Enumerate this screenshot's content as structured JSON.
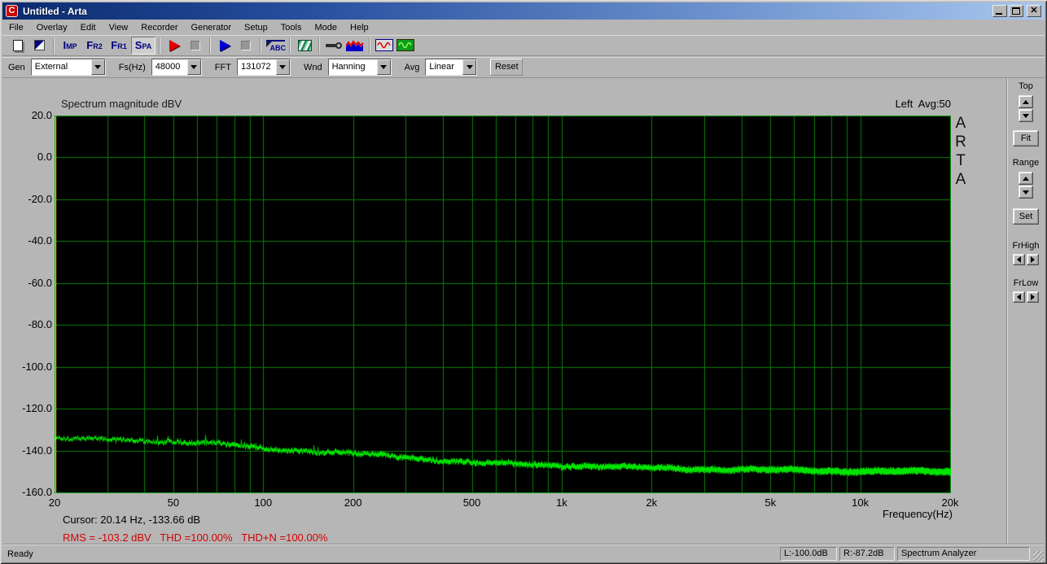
{
  "titlebar": {
    "title": "Untitled - Arta",
    "icon_letter": "C"
  },
  "menu": {
    "items": [
      "File",
      "Overlay",
      "Edit",
      "View",
      "Recorder",
      "Generator",
      "Setup",
      "Tools",
      "Mode",
      "Help"
    ]
  },
  "toolbar": {
    "imp": {
      "big": "I",
      "small": "MP"
    },
    "fr2": {
      "big": "F",
      "small": "R2"
    },
    "fr1": {
      "big": "F",
      "small": "R1"
    },
    "spa": {
      "big": "S",
      "small": "PA"
    },
    "abc_text": "ABC"
  },
  "controls": {
    "gen_label": "Gen",
    "gen_value": "External",
    "fs_label": "Fs(Hz)",
    "fs_value": "48000",
    "fft_label": "FFT",
    "fft_value": "131072",
    "wnd_label": "Wnd",
    "wnd_value": "Hanning",
    "avg_label": "Avg",
    "avg_value": "Linear",
    "reset_label": "Reset"
  },
  "side_panel": {
    "top_label": "Top",
    "fit_label": "Fit",
    "range_label": "Range",
    "set_label": "Set",
    "frhigh_label": "FrHigh",
    "frlow_label": "FrLow"
  },
  "status": {
    "ready": "Ready",
    "left_db": "L:-100.0dB",
    "right_db": "R:-87.2dB",
    "mode": "Spectrum Analyzer"
  },
  "chart_data": {
    "type": "line",
    "title": "Spectrum magnitude dBV",
    "channel_label": "Left  Avg:50",
    "xlabel": "Frequency(Hz)",
    "x_scale": "log",
    "x_range_hz": [
      20,
      20000
    ],
    "ylim": [
      -160,
      20
    ],
    "grid": true,
    "legend_position": "none",
    "watermark": "ARTA",
    "y_ticks": [
      {
        "label": "20.0",
        "db": 20
      },
      {
        "label": "0.0",
        "db": 0
      },
      {
        "label": "-20.0",
        "db": -20
      },
      {
        "label": "-40.0",
        "db": -40
      },
      {
        "label": "-60.0",
        "db": -60
      },
      {
        "label": "-80.0",
        "db": -80
      },
      {
        "label": "-100.0",
        "db": -100
      },
      {
        "label": "-120.0",
        "db": -120
      },
      {
        "label": "-140.0",
        "db": -140
      },
      {
        "label": "-160.0",
        "db": -160
      }
    ],
    "x_ticks": [
      {
        "label": "20",
        "hz": 20
      },
      {
        "label": "50",
        "hz": 50
      },
      {
        "label": "100",
        "hz": 100
      },
      {
        "label": "200",
        "hz": 200
      },
      {
        "label": "500",
        "hz": 500
      },
      {
        "label": "1k",
        "hz": 1000
      },
      {
        "label": "2k",
        "hz": 2000
      },
      {
        "label": "5k",
        "hz": 5000
      },
      {
        "label": "10k",
        "hz": 10000
      },
      {
        "label": "20k",
        "hz": 20000
      }
    ],
    "colors": {
      "plot_background": "#000000",
      "grid": "#0b7d0b",
      "border": "#0a9e0a",
      "trace": "#00e400",
      "cursor_line": "#ffff00",
      "readout_warning": "#d40000"
    },
    "cursor_hz": 20.14,
    "cursor_db": -133.66,
    "cursor_readout": "Cursor: 20.14 Hz, -133.66 dB",
    "rms_readout": "RMS = -103.2 dBV   THD =100.00%   THD+N =100.00%",
    "noise_floor": {
      "hz": [
        20,
        30,
        50,
        70,
        100,
        150,
        200,
        300,
        500,
        1000,
        2000,
        5000,
        10000,
        20000
      ],
      "dbv": [
        -134.2,
        -134.8,
        -135.7,
        -136.8,
        -139.0,
        -140.5,
        -141.5,
        -143.2,
        -145.8,
        -147.1,
        -148.3,
        -149.4,
        -149.8,
        -150.2
      ]
    }
  }
}
